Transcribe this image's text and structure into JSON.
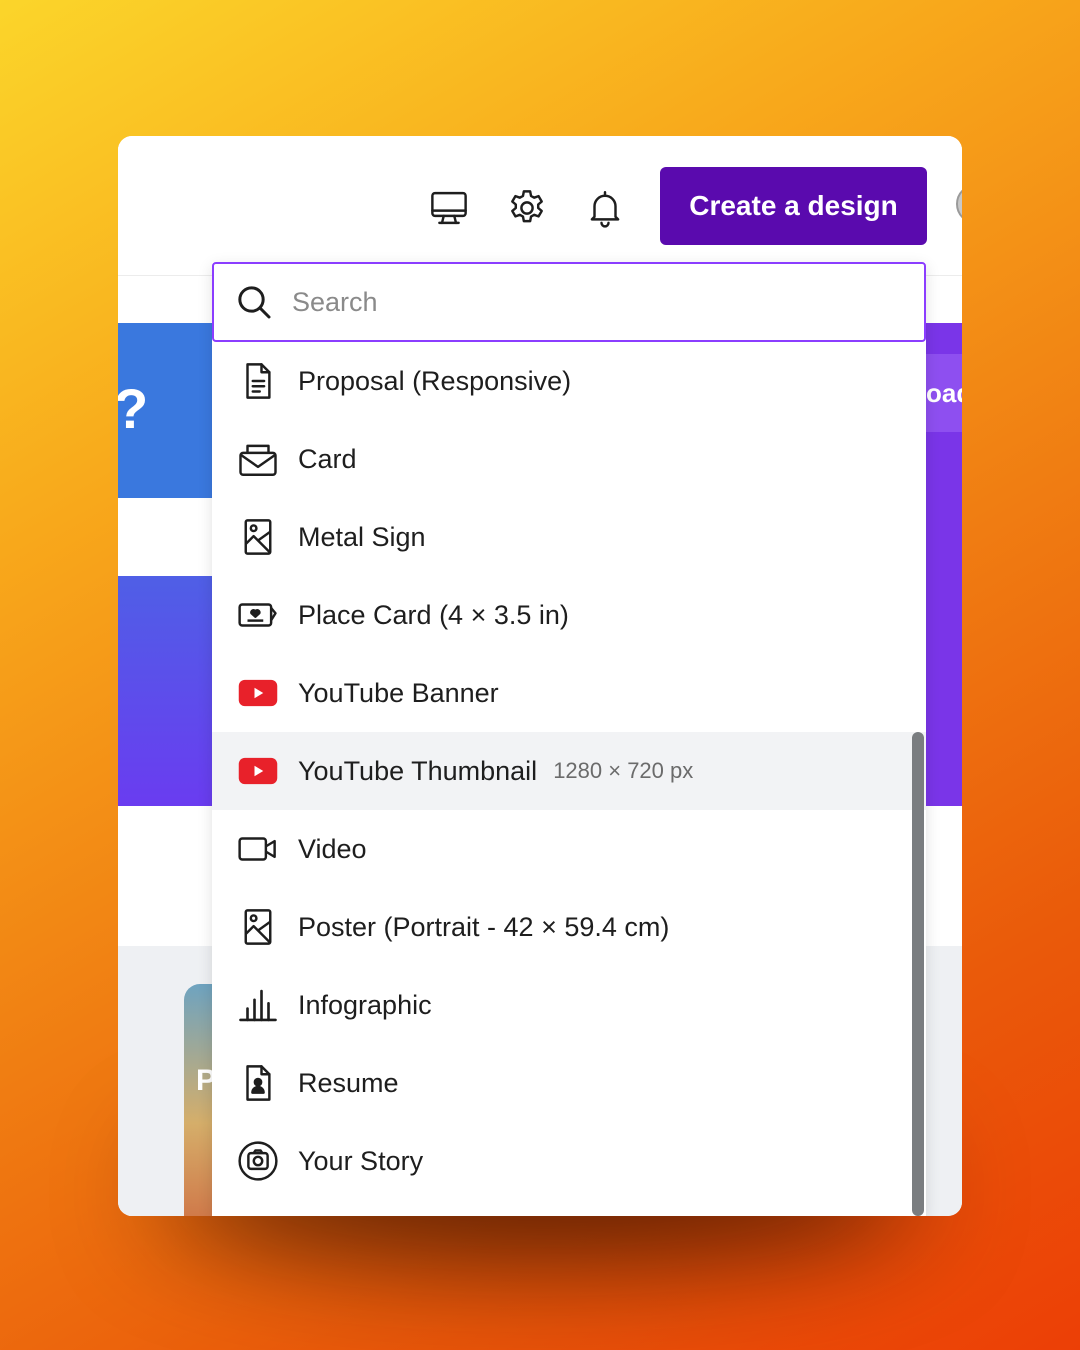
{
  "topbar": {
    "create_button_label": "Create a design",
    "icons": [
      "desktop-icon",
      "gear-icon",
      "bell-icon"
    ]
  },
  "background": {
    "left_fragment": "?",
    "right_fragment": "oad",
    "card_fragment": "P"
  },
  "search": {
    "placeholder": "Search"
  },
  "items": [
    {
      "label": "Proposal (Responsive)",
      "icon": "document-icon"
    },
    {
      "label": "Card",
      "icon": "envelope-icon"
    },
    {
      "label": "Metal Sign",
      "icon": "image-portrait-icon"
    },
    {
      "label": "Place Card (4 × 3.5 in)",
      "icon": "place-card-icon"
    },
    {
      "label": "YouTube Banner",
      "icon": "youtube-icon"
    },
    {
      "label": "YouTube Thumbnail",
      "meta": "1280 × 720 px",
      "icon": "youtube-icon",
      "highlighted": true
    },
    {
      "label": "Video",
      "icon": "video-camera-icon"
    },
    {
      "label": "Poster (Portrait - 42 × 59.4 cm)",
      "icon": "image-portrait-icon"
    },
    {
      "label": "Infographic",
      "icon": "bar-chart-icon"
    },
    {
      "label": "Resume",
      "icon": "resume-icon"
    },
    {
      "label": "Your Story",
      "icon": "instagram-icon"
    }
  ],
  "colors": {
    "brand_purple": "#5a0aae",
    "search_border": "#8b3dff",
    "youtube_red": "#e8212a",
    "highlight_row": "#f2f3f5"
  }
}
